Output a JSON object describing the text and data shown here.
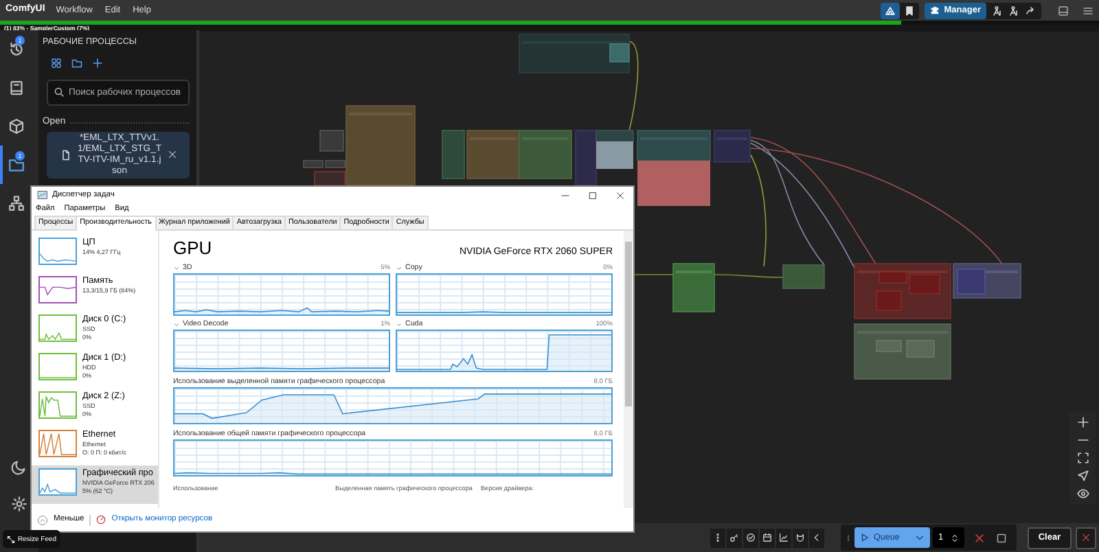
{
  "menu_bar": {
    "app_name": "ComfyUI",
    "items": [
      "Workflow",
      "Edit",
      "Help"
    ]
  },
  "top_toggles": [
    {
      "selected": true
    },
    {
      "selected": false
    }
  ],
  "manager_button": {
    "label": "Manager"
  },
  "progress": {
    "text": "(1) 83% - SamplerCustom (7%)",
    "level": 0.82
  },
  "rail": {
    "items": [
      {
        "selected": false,
        "badge": "1"
      },
      {
        "selected": false
      },
      {
        "selected": false
      },
      {
        "selected": true,
        "badge": "1"
      },
      {
        "selected": false
      }
    ]
  },
  "sidebar": {
    "title": "РАБОЧИЕ ПРОЦЕССЫ",
    "search": {
      "placeholder": "Поиск рабочих процессов"
    },
    "section": "Open",
    "open_workflows": [
      {
        "name": "*EML_LTX_TTVv1.1/EML_LTX_STG_TTV-ITV-IM_ru_v1.1.json",
        "selected": true
      }
    ]
  },
  "task_manager": {
    "title": "Диспетчер задач",
    "menu": [
      "Файл",
      "Параметры",
      "Вид"
    ],
    "tabs": [
      {
        "label": "Процессы",
        "selected": false
      },
      {
        "label": "Производительность",
        "selected": true
      },
      {
        "label": "Журнал приложений",
        "selected": false
      },
      {
        "label": "Автозагрузка",
        "selected": false
      },
      {
        "label": "Пользователи",
        "selected": false
      },
      {
        "label": "Подробности",
        "selected": false
      },
      {
        "label": "Службы",
        "selected": false
      }
    ],
    "resources": [
      {
        "name": "ЦП",
        "details": [
          "14% 4,27 ГГц"
        ],
        "color": "#4a9fd8",
        "selected": false
      },
      {
        "name": "Память",
        "details": [
          "13,3/15,9 ГБ (84%)"
        ],
        "color": "#a04fb8",
        "selected": false
      },
      {
        "name": "Диск 0 (C:)",
        "details": [
          "SSD",
          "0%"
        ],
        "color": "#6cbf3c",
        "selected": false
      },
      {
        "name": "Диск 1 (D:)",
        "details": [
          "HDD",
          "0%"
        ],
        "color": "#6cbf3c",
        "selected": false
      },
      {
        "name": "Диск 2 (Z:)",
        "details": [
          "SSD",
          "0%"
        ],
        "color": "#6cbf3c",
        "selected": false
      },
      {
        "name": "Ethernet",
        "details": [
          "Ethernet",
          "О: 0 П: 0 кбит/с"
        ],
        "color": "#d7823a",
        "selected": false
      },
      {
        "name": "Графический про",
        "details": [
          "NVIDIA GeForce RTX 206",
          "5% (62 °C)"
        ],
        "color": "#4a9fd8",
        "selected": true
      }
    ],
    "gpu": {
      "title": "GPU",
      "model": "NVIDIA GeForce RTX 2060 SUPER",
      "engines": [
        {
          "label": "3D",
          "reading": "5%"
        },
        {
          "label": "Copy",
          "reading": "0%"
        },
        {
          "label": "Video Decode",
          "reading": "1%"
        },
        {
          "label": "Cuda",
          "reading": "100%"
        }
      ],
      "memory_graphs": [
        {
          "label": "Использование выделенной памяти графического процессора",
          "reading": "8,0 ГБ"
        },
        {
          "label": "Использование общей памяти графического процессора",
          "reading": "8,0 ГБ"
        }
      ],
      "stats": [
        "Использование",
        "Выделенная память графического процессора",
        "Версия драйвера:"
      ]
    },
    "footer": {
      "less": "Меньше",
      "link": "Открыть монитор ресурсов"
    }
  },
  "bottom_bar": {
    "queue_button": "Queue",
    "batch_count": "1",
    "clear_button": "Clear"
  },
  "resize_feed": "Resize Feed"
}
